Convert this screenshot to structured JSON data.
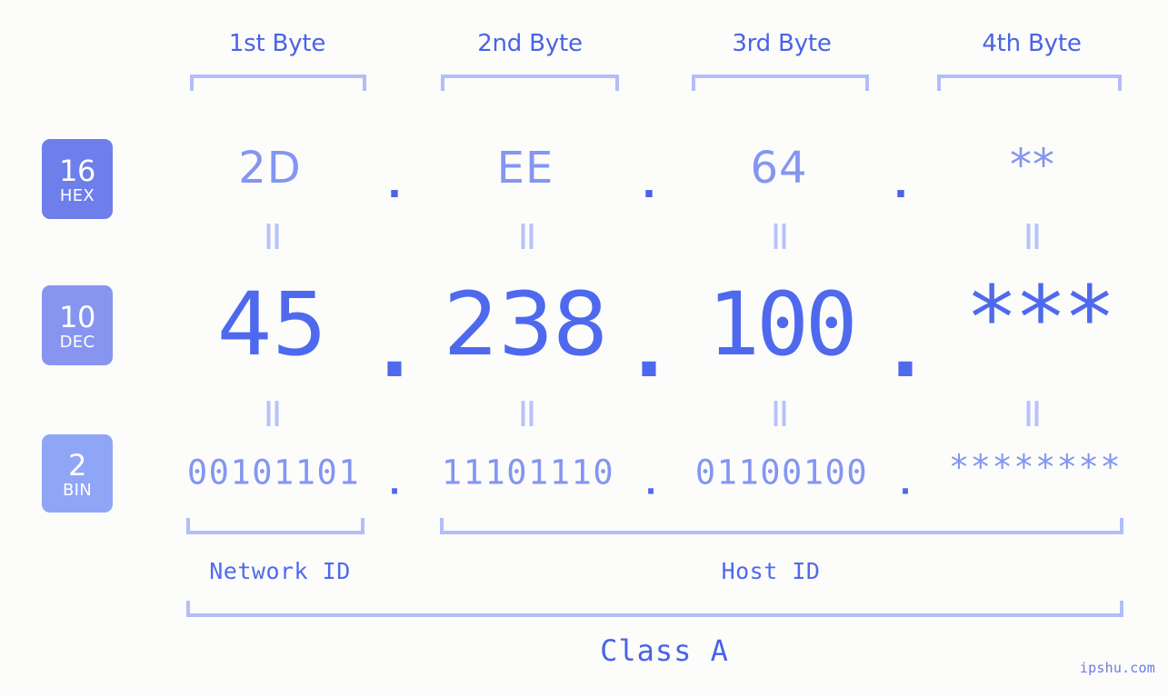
{
  "page": {
    "background_color": "#fcfdfa",
    "accent_color": "#4f69ee",
    "light_accent_color": "#8495f2",
    "bracket_color": "#b3bdfb",
    "watermark": "ipshu.com"
  },
  "byte_headers": [
    {
      "label": "1st Byte"
    },
    {
      "label": "2nd Byte"
    },
    {
      "label": "3rd Byte"
    },
    {
      "label": "4th Byte"
    }
  ],
  "radix_badges": [
    {
      "number": "16",
      "name": "HEX",
      "color": "#6e7eeb"
    },
    {
      "number": "10",
      "name": "DEC",
      "color": "#8795f0"
    },
    {
      "number": "2",
      "name": "BIN",
      "color": "#8fa6f7"
    }
  ],
  "rows": {
    "hex": {
      "radix": "16",
      "radix_name": "HEX",
      "bytes": [
        "2D",
        "EE",
        "64",
        "**"
      ],
      "separator": "."
    },
    "dec": {
      "radix": "10",
      "radix_name": "DEC",
      "bytes": [
        "45",
        "238",
        "100",
        "***"
      ],
      "separator": "."
    },
    "bin": {
      "radix": "2",
      "radix_name": "BIN",
      "bytes": [
        "00101101",
        "11101110",
        "01100100",
        "********"
      ],
      "separator": "."
    }
  },
  "equals_marker": "||",
  "footer": {
    "network_id_label": "Network ID",
    "host_id_label": "Host ID",
    "class_label": "Class A"
  }
}
